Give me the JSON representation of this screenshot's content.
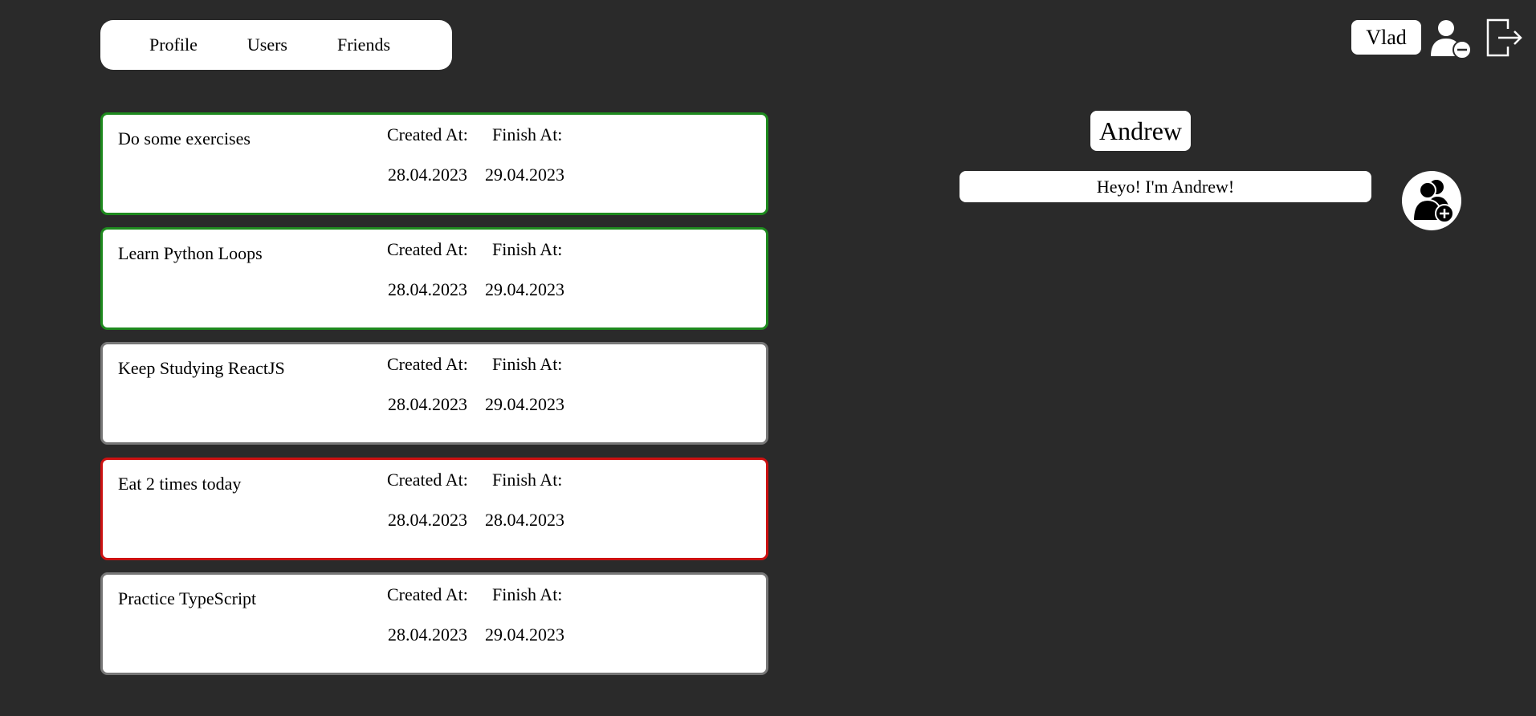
{
  "nav": {
    "items": [
      {
        "label": "Profile"
      },
      {
        "label": "Users"
      },
      {
        "label": "Friends"
      }
    ]
  },
  "header": {
    "current_user": "Vlad",
    "remove_user_icon": "user-minus-icon",
    "logout_icon": "logout-icon"
  },
  "task_labels": {
    "created": "Created At:",
    "finish": "Finish At:"
  },
  "tasks": [
    {
      "title": "Do some exercises",
      "created_at": "28.04.2023",
      "finish_at": "29.04.2023",
      "status": "done"
    },
    {
      "title": "Learn Python Loops",
      "created_at": "28.04.2023",
      "finish_at": "29.04.2023",
      "status": "done"
    },
    {
      "title": "Keep Studying ReactJS",
      "created_at": "28.04.2023",
      "finish_at": "29.04.2023",
      "status": "pending"
    },
    {
      "title": "Eat 2 times today",
      "created_at": "28.04.2023",
      "finish_at": "28.04.2023",
      "status": "failed"
    },
    {
      "title": "Practice TypeScript",
      "created_at": "28.04.2023",
      "finish_at": "29.04.2023",
      "status": "pending"
    }
  ],
  "friend": {
    "name": "Andrew",
    "bio": "Heyo! I'm Andrew!",
    "add_icon": "add-friend-icon"
  },
  "colors": {
    "background": "#2a2a2a",
    "done_border": "#1e8a1e",
    "failed_border": "#cc1111",
    "pending_border": "#777777"
  }
}
